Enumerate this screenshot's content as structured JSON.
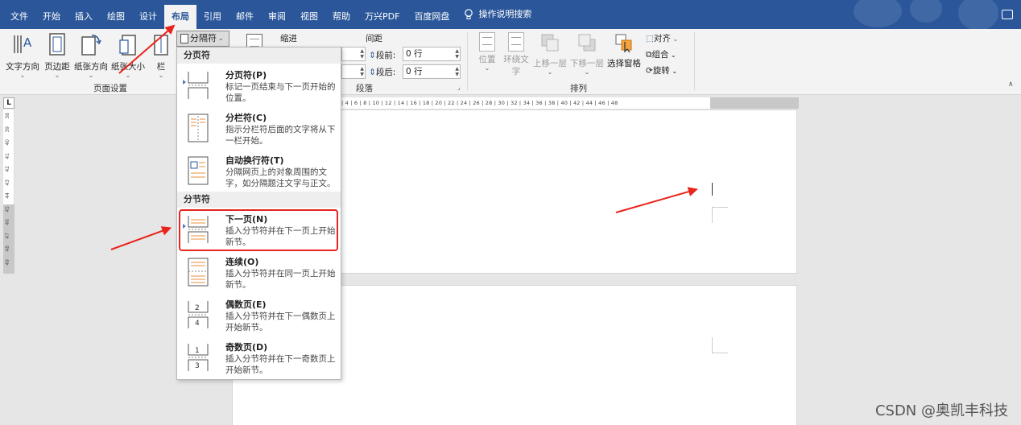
{
  "tabs": [
    "文件",
    "开始",
    "插入",
    "绘图",
    "设计",
    "布局",
    "引用",
    "邮件",
    "审阅",
    "视图",
    "帮助",
    "万兴PDF",
    "百度网盘"
  ],
  "active_tab": "布局",
  "search_label": "操作说明搜索",
  "ribbon": {
    "text_direction": "文字方向",
    "margins": "页边距",
    "orientation": "纸张方向",
    "size": "纸张大小",
    "columns": "栏",
    "breaks": "分隔符",
    "page_setup_group": "页面设置",
    "indent": "缩进",
    "spacing": "间距",
    "before_label": "段前:",
    "before_value": "0 行",
    "after_label": "段后:",
    "after_value": "0 行",
    "paragraph_group": "段落",
    "position": "位置",
    "wrap_text_1": "环绕文",
    "wrap_text_2": "字",
    "bring_forward": "上移一层",
    "send_backward": "下移一层",
    "selection_pane": "选择窗格",
    "align": "对齐",
    "group": "组合",
    "rotate": "旋转",
    "arrange_group": "排列"
  },
  "ruler_ticks": [
    "4",
    "6",
    "8",
    "10",
    "12",
    "14",
    "16",
    "18",
    "20",
    "22",
    "24",
    "26",
    "28",
    "30",
    "32",
    "34",
    "36",
    "38",
    "40",
    "42",
    "44",
    "46",
    "48"
  ],
  "left_ruler_ticks": [
    "38",
    "39",
    "40",
    "41",
    "42",
    "43",
    "44",
    "45",
    "46",
    "47",
    "48",
    "49"
  ],
  "dropdown": {
    "page_breaks_header": "分页符",
    "section_breaks_header": "分节符",
    "items": [
      {
        "title": "分页符(P)",
        "desc": "标记一页结束与下一页开始的位置。"
      },
      {
        "title": "分栏符(C)",
        "desc": "指示分栏符后面的文字将从下一栏开始。"
      },
      {
        "title": "自动换行符(T)",
        "desc": "分隔网页上的对象周围的文字，如分隔题注文字与正文。"
      },
      {
        "title": "下一页(N)",
        "desc": "插入分节符并在下一页上开始新节。"
      },
      {
        "title": "连续(O)",
        "desc": "插入分节符并在同一页上开始新节。"
      },
      {
        "title": "偶数页(E)",
        "desc": "插入分节符并在下一偶数页上开始新节。"
      },
      {
        "title": "奇数页(D)",
        "desc": "插入分节符并在下一奇数页上开始新节。"
      }
    ],
    "even_icon_nums": [
      "2",
      "4"
    ],
    "odd_icon_nums": [
      "1",
      "3"
    ]
  },
  "watermark": "CSDN @奥凯丰科技",
  "colors": {
    "tabbar": "#2b579a",
    "annotation_red": "#e8241c"
  }
}
